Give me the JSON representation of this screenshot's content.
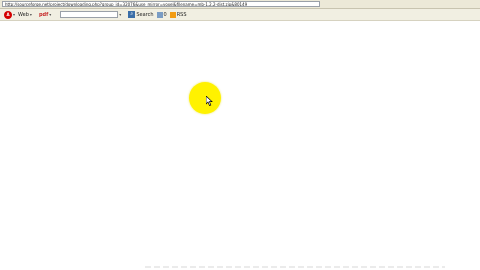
{
  "browser": {
    "address_url": "http://sourceforge.net/project/downloading.php?group_id=32076&use_mirror=voxel&filename=mb-1.2.2-dist.zip&80149"
  },
  "toolbar": {
    "brand_icon": "A",
    "web_label": "Web",
    "pdf_label": "pdf",
    "search_button_label": "Search",
    "counter_label": "0",
    "rss_label": "RSS"
  },
  "icons": {
    "brand": "ask-logo-icon",
    "dropdown": "chevron-down-icon",
    "search": "search-icon",
    "counter": "popup-blocker-icon",
    "rss": "rss-icon"
  },
  "cursor": {
    "highlight_color": "#fff200"
  }
}
